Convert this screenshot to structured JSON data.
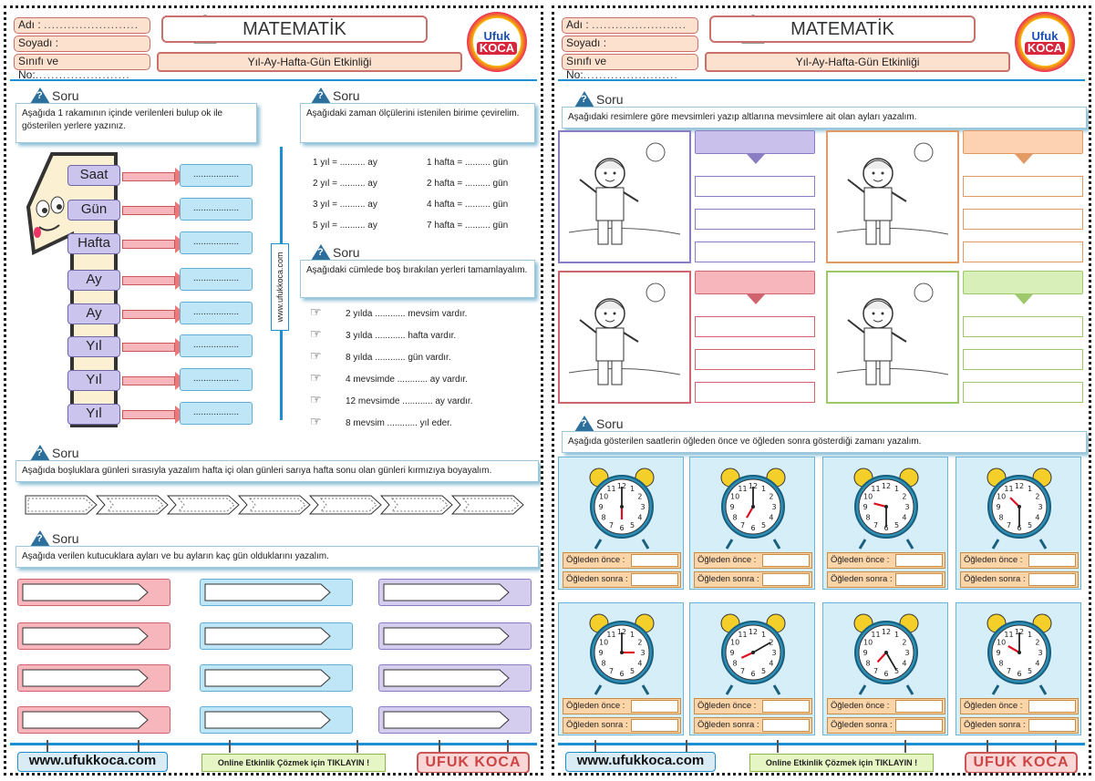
{
  "header": {
    "name_label": "Adı",
    "surname_label": "Soyadı",
    "class_label": "Sınıfı ve No:",
    "dots": "........................",
    "title": "MATEMATİK",
    "subtitle": "Yıl-Ay-Hafta-Gün Etkinliği",
    "logo_top": "Ufuk",
    "logo_bottom": "KOCA"
  },
  "soru_label": "Soru",
  "left": {
    "q1_text": "Aşağıda 1 rakamının içinde verilenleri bulup ok ile gösterilen yerlere yazınız.",
    "units": [
      "Saat",
      "Gün",
      "Hafta",
      "Ay",
      "Ay",
      "Yıl",
      "Yıl",
      "Yıl"
    ],
    "answer_dots": "..................",
    "q2_text": "Aşağıdaki zaman ölçülerini istenilen birime çevirelim.",
    "conversions_left": [
      "1 yıl = .......... ay",
      "2 yıl = .......... ay",
      "3 yıl = .......... ay",
      "5 yıl = .......... ay"
    ],
    "conversions_right": [
      "1 hafta = .......... gün",
      "2 hafta = .......... gün",
      "4 hafta = .......... gün",
      "7 hafta = .......... gün"
    ],
    "vertical_web": "www.ufukkoca.com",
    "q3_text": "Aşağıdaki cümlede boş bırakılan yerleri tamamlayalım.",
    "sentences": [
      "2 yılda ............ mevsim vardır.",
      "3 yılda ............ hafta vardır.",
      "8 yılda ............ gün vardır.",
      "4 mevsimde ............ ay vardır.",
      "12 mevsimde ............ ay vardır.",
      "8 mevsim ............ yıl eder."
    ],
    "q4_text": "Aşağıda boşluklara günleri sırasıyla yazalım hafta içi olan günleri sarıya hafta sonu olan günleri kırmızıya boyayalım.",
    "q5_text": "Aşağıda verilen kutucuklara ayları ve bu ayların kaç gün olduklarını yazalım."
  },
  "right": {
    "q1_text": "Aşağıdaki resimlere göre mevsimleri yazıp altlarına mevsimlere ait olan ayları yazalım.",
    "q2_text": "Aşağıda gösterilen saatlerin öğleden önce ve öğleden sonra gösterdiği zamanı yazalım.",
    "am_label": "Öğleden önce",
    "pm_label": "Öğleden sonra",
    "season_colors": [
      "#c9c1ec",
      "#fcd2b2",
      "#f7b6bb",
      "#d9efb9"
    ],
    "season_borders": [
      "#8a7dc4",
      "#e39b66",
      "#d0636d",
      "#9dc86b"
    ],
    "clocks": [
      {
        "hour": 6,
        "minute": 0
      },
      {
        "hour": 7,
        "minute": 0
      },
      {
        "hour": 9,
        "minute": 30
      },
      {
        "hour": 10,
        "minute": 30
      },
      {
        "hour": 3,
        "minute": 0
      },
      {
        "hour": 8,
        "minute": 10
      },
      {
        "hour": 7,
        "minute": 25
      },
      {
        "hour": 10,
        "minute": 0
      }
    ]
  },
  "footer": {
    "web": "www.ufukkoca.com",
    "online": "Online Etkinlik Çözmek için TIKLAYIN !",
    "name": "UFUK KOCA"
  }
}
